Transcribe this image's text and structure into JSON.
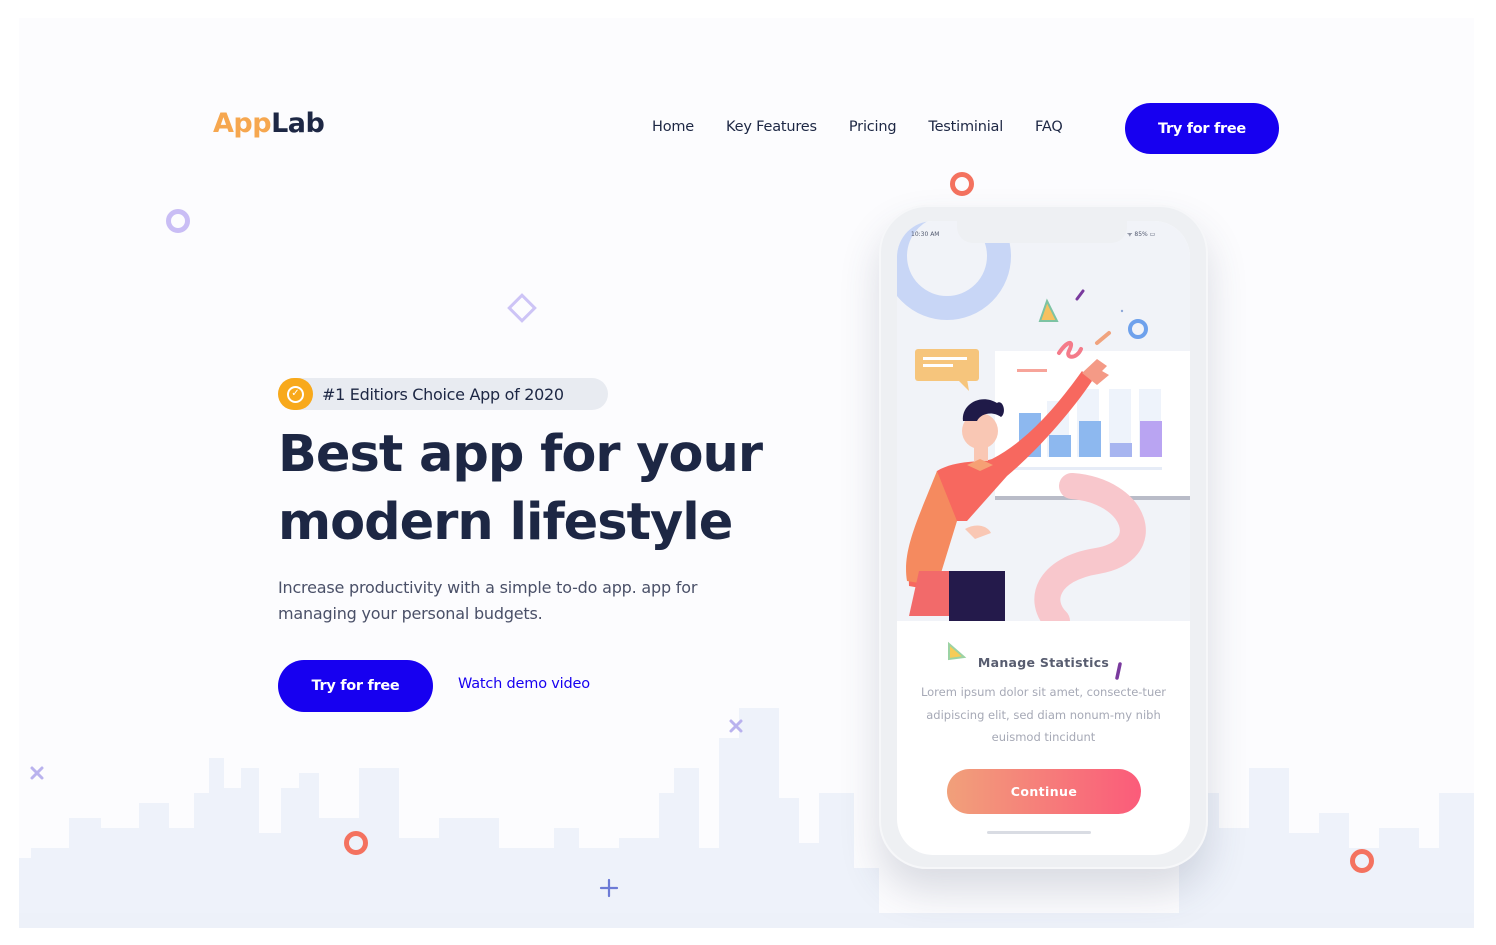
{
  "header": {
    "logo_part1": "App",
    "logo_part2": "Lab",
    "nav": [
      "Home",
      "Key Features",
      "Pricing",
      "Testiminial",
      "FAQ"
    ],
    "cta_label": "Try for free"
  },
  "hero": {
    "badge_text": "#1 Editiors Choice App of 2020",
    "headline_line1": "Best app for your",
    "headline_line2": "modern lifestyle",
    "subtitle": "Increase productivity with a simple to-do app. app for managing your personal budgets.",
    "cta_label": "Try for free",
    "demo_link": "Watch demo video"
  },
  "phone": {
    "status_time": "10:30 AM",
    "status_battery": "85%",
    "card_title": "Manage Statistics",
    "card_body": "Lorem ipsum dolor sit amet, consecte-tuer adipiscing elit, sed diam nonum-my nibh euismod tincidunt",
    "continue_label": "Continue"
  },
  "colors": {
    "brand_blue": "#1700f0",
    "logo_orange": "#f6a74f",
    "navy": "#1d2744",
    "badge_orange": "#f8a91b",
    "coral": "#f26a5a"
  }
}
